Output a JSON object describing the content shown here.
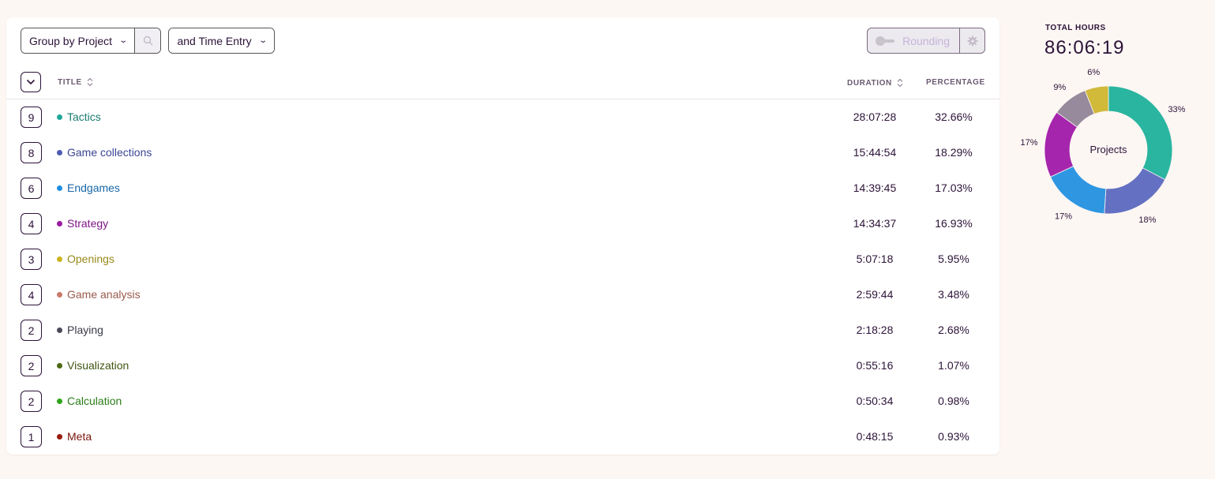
{
  "toolbar": {
    "group_by_label": "Group by Project",
    "sub_group_label": "and Time Entry",
    "rounding_label": "Rounding"
  },
  "table": {
    "col_title": "TITLE",
    "col_duration": "DURATION",
    "col_percentage": "PERCENTAGE",
    "rows": [
      {
        "count": "9",
        "title": "Tactics",
        "duration": "28:07:28",
        "percentage": "32.66%",
        "color": "#1fa79a",
        "text_color": "#197b70"
      },
      {
        "count": "8",
        "title": "Game collections",
        "duration": "15:44:54",
        "percentage": "18.29%",
        "color": "#4f5bb4",
        "text_color": "#3b4593"
      },
      {
        "count": "6",
        "title": "Endgames",
        "duration": "14:39:45",
        "percentage": "17.03%",
        "color": "#1f8ee0",
        "text_color": "#1867a8"
      },
      {
        "count": "4",
        "title": "Strategy",
        "duration": "14:34:37",
        "percentage": "16.93%",
        "color": "#9b1ba3",
        "text_color": "#7e1685"
      },
      {
        "count": "3",
        "title": "Openings",
        "duration": "5:07:18",
        "percentage": "5.95%",
        "color": "#c9b41d",
        "text_color": "#9a8a1a"
      },
      {
        "count": "4",
        "title": "Game analysis",
        "duration": "2:59:44",
        "percentage": "3.48%",
        "color": "#c97a68",
        "text_color": "#9a5a4c"
      },
      {
        "count": "2",
        "title": "Playing",
        "duration": "2:18:28",
        "percentage": "2.68%",
        "color": "#4a4a5a",
        "text_color": "#3a3a48"
      },
      {
        "count": "2",
        "title": "Visualization",
        "duration": "0:55:16",
        "percentage": "1.07%",
        "color": "#4d6b12",
        "text_color": "#3f5410"
      },
      {
        "count": "2",
        "title": "Calculation",
        "duration": "0:50:34",
        "percentage": "0.98%",
        "color": "#2ea619",
        "text_color": "#2a7d18"
      },
      {
        "count": "1",
        "title": "Meta",
        "duration": "0:48:15",
        "percentage": "0.93%",
        "color": "#9c1a0e",
        "text_color": "#7a150b"
      }
    ]
  },
  "summary": {
    "total_label": "TOTAL HOURS",
    "total_value": "86:06:19"
  },
  "chart_data": {
    "type": "pie",
    "center_label": "Projects",
    "slices": [
      {
        "label": "33%",
        "value": 32.66,
        "color": "#2ab5a0"
      },
      {
        "label": "18%",
        "value": 18.29,
        "color": "#6470c2"
      },
      {
        "label": "17%",
        "value": 17.03,
        "color": "#2f96e2"
      },
      {
        "label": "17%",
        "value": 16.93,
        "color": "#a625ad"
      },
      {
        "label": "9%",
        "value": 9.0,
        "color": "#978a9c"
      },
      {
        "label": "6%",
        "value": 5.95,
        "color": "#d1b93a"
      }
    ]
  }
}
